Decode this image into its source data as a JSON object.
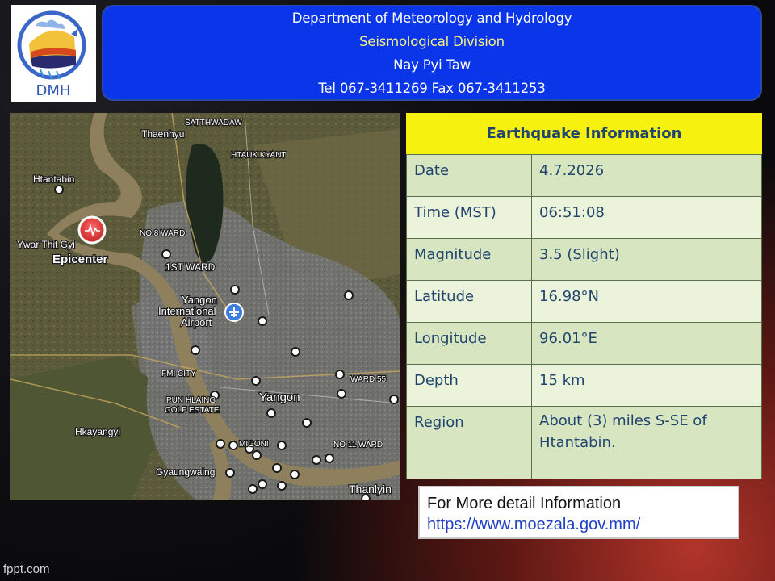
{
  "header": {
    "line1": "Department of Meteorology and Hydrology",
    "line2": "Seismological Division",
    "line3": "Nay Pyi Taw",
    "line4": "Tel 067-3411269 Fax 067-3411253"
  },
  "logo": {
    "text": "DMH"
  },
  "map": {
    "epicenter_label": "Epicenter",
    "place_labels": {
      "satthwadaw": "SATTHWADAW",
      "thaenhyu": "Thaenhyu",
      "htauk_kyant": "HTAUK KYANT",
      "htantabin": "Htantabin",
      "ywar_thit_gyi": "Ywar Thit Gyi",
      "no8_ward": "NO 8 WARD",
      "first_ward": "1ST WARD",
      "yangon_airport_1": "Yangon",
      "yangon_airport_2": "International",
      "yangon_airport_3": "Airport",
      "fmi_city": "FMI CITY",
      "pun_hlaing_1": "PUN HLAING",
      "pun_hlaing_2": "GOLF ESTATE",
      "yangon": "Yangon",
      "ward55": "WARD 55",
      "hkayangyi": "Hkayangyi",
      "mingon": "MIGONI",
      "no11_ward": "NO 11 WARD",
      "gyaungwaing": "Gyaungwaing",
      "thanlyin": "Thanlyin"
    },
    "colors": {
      "land": "#5c5a3c",
      "river": "#8d7f5e",
      "urban": "#77787a",
      "epicenter": "#e23b3b"
    }
  },
  "info": {
    "title": "Earthquake Information",
    "rows": [
      {
        "key": "Date",
        "value": "4.7.2026"
      },
      {
        "key": "Time (MST)",
        "value": "06:51:08"
      },
      {
        "key": "Magnitude",
        "value": "3.5 (Slight)"
      },
      {
        "key": "Latitude",
        "value": "16.98°N"
      },
      {
        "key": "Longitude",
        "value": "96.01°E"
      },
      {
        "key": "Depth",
        "value": "15 km"
      },
      {
        "key": "Region",
        "value": "About (3) miles S-SE of Htantabin."
      }
    ]
  },
  "more_info": {
    "line1": "For More detail Information",
    "line2": "https://www.moezala.gov.mm/"
  },
  "footer": {
    "watermark": "fppt.com"
  }
}
